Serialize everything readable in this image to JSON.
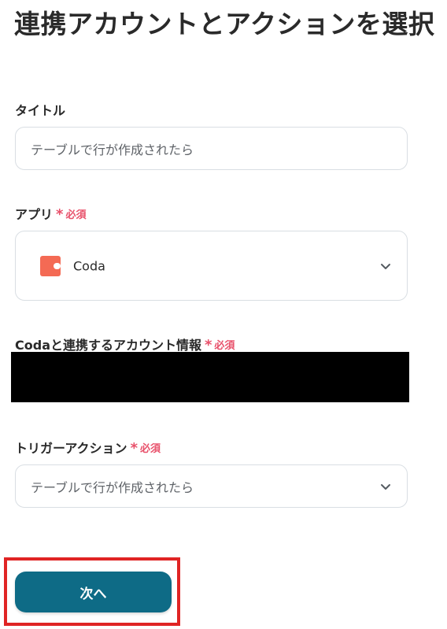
{
  "page": {
    "title": "連携アカウントとアクションを選択"
  },
  "fields": {
    "title_field": {
      "label": "タイトル",
      "value": "テーブルで行が作成されたら"
    },
    "app_field": {
      "label": "アプリ",
      "required_mark": "*",
      "required_text": "必須",
      "value": "Coda",
      "icon": "coda-app-icon"
    },
    "account_field": {
      "label": "Codaと連携するアカウント情報",
      "required_mark": "*",
      "required_text": "必須"
    },
    "trigger_field": {
      "label": "トリガーアクション",
      "required_mark": "*",
      "required_text": "必須",
      "value": "テーブルで行が作成されたら"
    }
  },
  "actions": {
    "next_label": "次へ"
  },
  "colors": {
    "required": "#e8506a",
    "primary_button": "#0e6b86",
    "highlight_frame": "#e02424",
    "coda_brand": "#f46a54"
  }
}
